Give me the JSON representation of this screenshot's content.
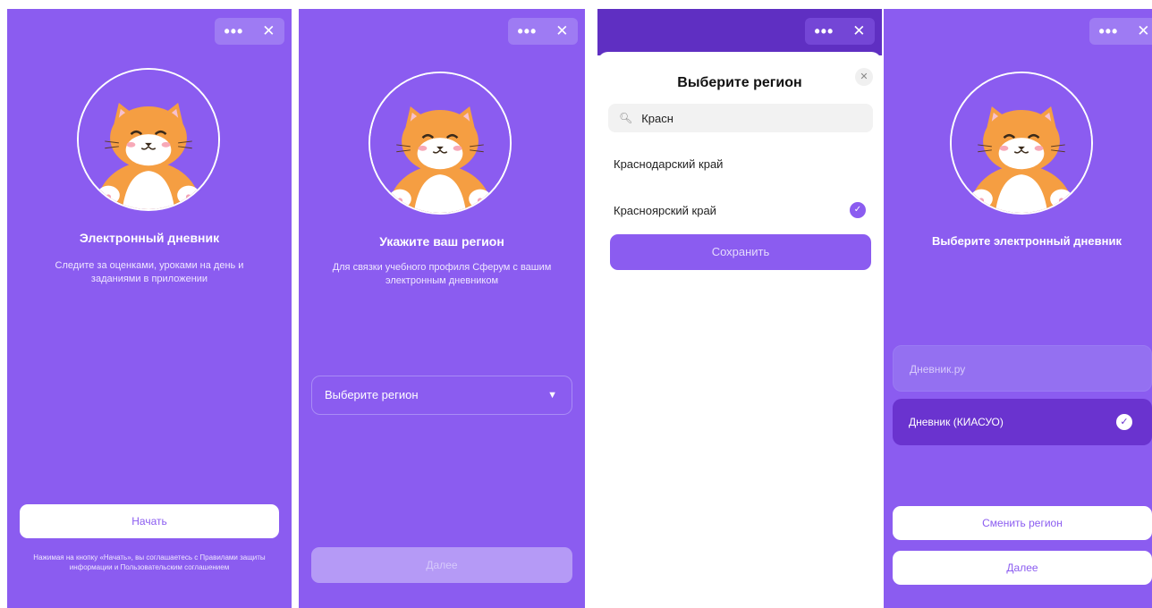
{
  "controls": {
    "more_icon": "more-icon",
    "close_icon": "close-icon"
  },
  "colors": {
    "brand_purple": "#8b5cf0",
    "dark_purple": "#6a33cf",
    "header_purple": "#5f2fc2",
    "white": "#ffffff"
  },
  "screen1": {
    "title": "Электронный дневник",
    "subtitle": "Следите за оценками, уроками на день и заданиями в приложении",
    "start_button": "Начать",
    "legal_text": "Нажимая на кнопку «Начать», вы соглашаетесь с Правилами защиты информации и Пользовательским соглашением"
  },
  "screen2": {
    "title": "Укажите ваш регион",
    "subtitle": "Для связки учебного профиля Сферум с вашим электронным дневником",
    "select_placeholder": "Выберите регион",
    "next_button": "Далее"
  },
  "screen3": {
    "title": "Выберите регион",
    "search_value": "Красн",
    "options": [
      {
        "label": "Краснодарский край",
        "selected": false
      },
      {
        "label": "Красноярский край",
        "selected": true
      }
    ],
    "save_button": "Сохранить"
  },
  "screen4": {
    "title": "Выберите электронный дневник",
    "diaries": [
      {
        "label": "Дневник.ру",
        "selected": false
      },
      {
        "label": "Дневник (КИАСУО)",
        "selected": true
      }
    ],
    "change_region_button": "Сменить регион",
    "next_button": "Далее"
  }
}
